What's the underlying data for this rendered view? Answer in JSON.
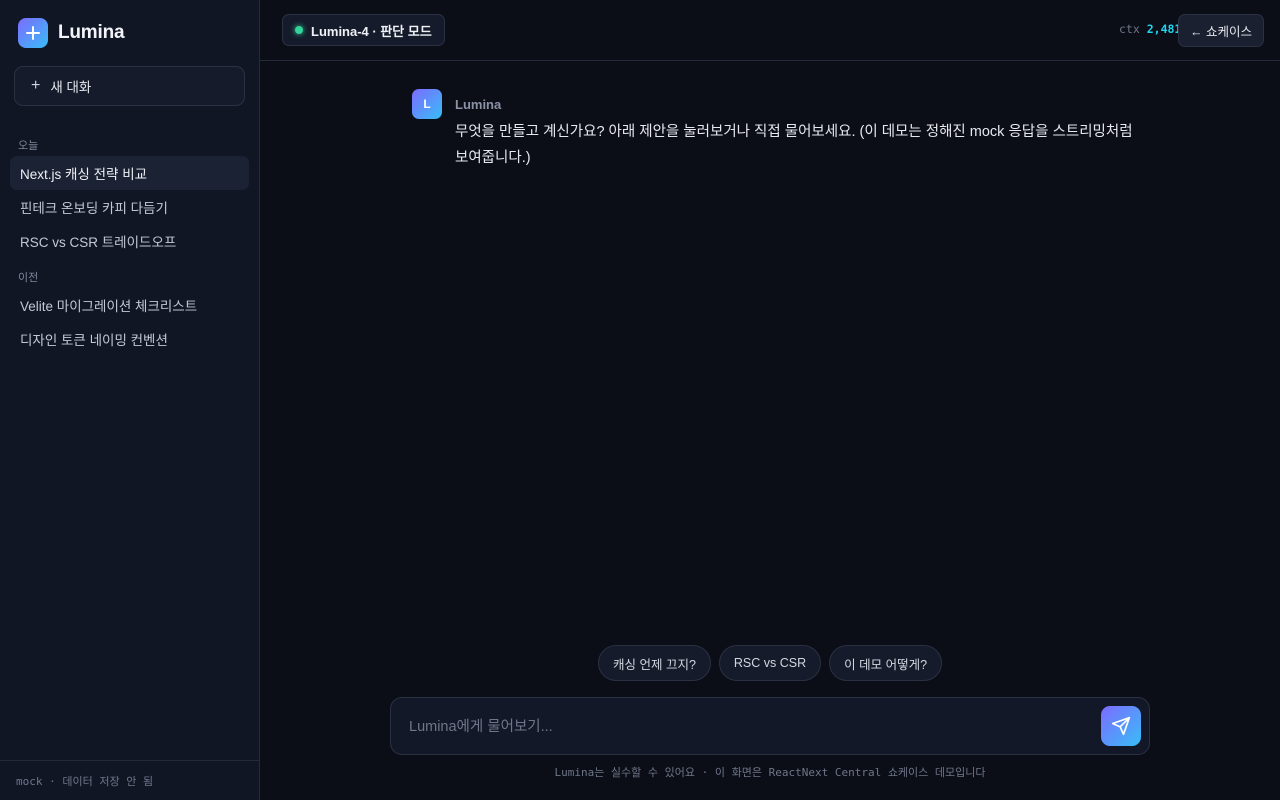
{
  "app": {
    "name": "Lumina"
  },
  "sidebar": {
    "new_chat_label": "새 대화",
    "sections": [
      {
        "label": "오늘",
        "items": [
          "Next.js 캐싱 전략 비교",
          "핀테크 온보딩 카피 다듬기",
          "RSC vs CSR 트레이드오프"
        ]
      },
      {
        "label": "이전",
        "items": [
          "Velite 마이그레이션 체크리스트",
          "디자인 토큰 네이밍 컨벤션"
        ]
      }
    ],
    "footer": "mock · 데이터 저장 안 됨"
  },
  "topbar": {
    "model_label": "Lumina-4 · 판단 모드",
    "status": "online",
    "ctx_label": "ctx",
    "ctx_value": "2,481",
    "showcase_label": "← 쇼케이스"
  },
  "message": {
    "avatar_letter": "L",
    "sender": "Lumina",
    "text": "무엇을 만들고 계신가요? 아래 제안을 눌러보거나 직접 물어보세요. (이 데모는 정해진 mock 응답을 스트리밍처럼 보여줍니다.)"
  },
  "suggestions": [
    "캐싱 언제 끄지?",
    "RSC vs CSR",
    "이 데모 어떻게?"
  ],
  "composer": {
    "placeholder": "Lumina에게 물어보기..."
  },
  "disclaimer": "Lumina는 실수할 수 있어요 · 이 화면은 ReactNext Central 쇼케이스 데모입니다",
  "colors": {
    "accent_start": "#7c6bff",
    "accent_end": "#38bdf8",
    "status_green": "#34d399",
    "ctx_cyan": "#22d3ee"
  }
}
